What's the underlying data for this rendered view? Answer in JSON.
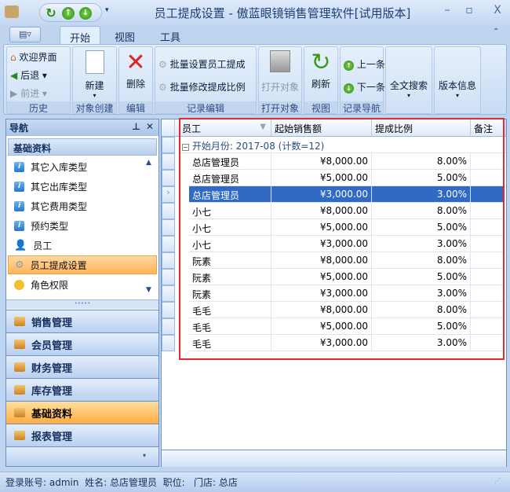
{
  "window": {
    "title": "员工提成设置 - 傲蓝眼镜销售管理软件[试用版本]",
    "minimize": "–",
    "maximize": "▫",
    "close": "X"
  },
  "ribbon_tabs": [
    {
      "label": "开始",
      "active": true
    },
    {
      "label": "视图"
    },
    {
      "label": "工具"
    }
  ],
  "ribbon": {
    "history": {
      "label": "历史",
      "welcome": "欢迎界面",
      "back": "后退",
      "forward": "前进"
    },
    "create": {
      "label": "对象创建",
      "new": "新建"
    },
    "edit": {
      "label": "编辑",
      "delete": "删除"
    },
    "record_edit": {
      "label": "记录编辑",
      "batch_set": "批量设置员工提成",
      "batch_modify": "批量修改提成比例"
    },
    "open": {
      "label": "打开对象",
      "open": "打开对象"
    },
    "view": {
      "label": "视图",
      "refresh": "刷新"
    },
    "nav": {
      "label": "记录导航",
      "prev": "上一条",
      "next": "下一条"
    },
    "search": "全文搜索",
    "version": "版本信息"
  },
  "nav": {
    "title": "导航",
    "pin": "ᵖ",
    "close": "✕",
    "section": "基础资料",
    "items": [
      {
        "label": "其它入库类型",
        "icon": "info-icon"
      },
      {
        "label": "其它出库类型",
        "icon": "info-icon"
      },
      {
        "label": "其它费用类型",
        "icon": "info-icon"
      },
      {
        "label": "预约类型",
        "icon": "info-icon"
      },
      {
        "label": "员工",
        "icon": "user-icon"
      },
      {
        "label": "员工提成设置",
        "icon": "gear-icon",
        "selected": true
      },
      {
        "label": "角色权限",
        "icon": "mask-icon"
      }
    ],
    "groups": [
      {
        "label": "销售管理"
      },
      {
        "label": "会员管理"
      },
      {
        "label": "财务管理"
      },
      {
        "label": "库存管理"
      },
      {
        "label": "基础资料",
        "selected": true
      },
      {
        "label": "报表管理"
      }
    ]
  },
  "grid": {
    "columns": [
      "员工",
      "起始销售额",
      "提成比例",
      "备注"
    ],
    "group_row": "开始月份: 2017-08 (计数=12)",
    "rows": [
      [
        "总店管理员",
        "¥8,000.00",
        "8.00%"
      ],
      [
        "总店管理员",
        "¥5,000.00",
        "5.00%"
      ],
      [
        "总店管理员",
        "¥3,000.00",
        "3.00%"
      ],
      [
        "小七",
        "¥8,000.00",
        "8.00%"
      ],
      [
        "小七",
        "¥5,000.00",
        "5.00%"
      ],
      [
        "小七",
        "¥3,000.00",
        "3.00%"
      ],
      [
        "阮素",
        "¥8,000.00",
        "8.00%"
      ],
      [
        "阮素",
        "¥5,000.00",
        "5.00%"
      ],
      [
        "阮素",
        "¥3,000.00",
        "3.00%"
      ],
      [
        "毛毛",
        "¥8,000.00",
        "8.00%"
      ],
      [
        "毛毛",
        "¥5,000.00",
        "5.00%"
      ],
      [
        "毛毛",
        "¥3,000.00",
        "3.00%"
      ]
    ],
    "selected_row": 2
  },
  "status": "登录账号: admin  姓名: 总店管理员  职位:   门店: 总店",
  "colors": {
    "accent": "#316ac5",
    "highlight": "#e8282c",
    "selected_nav": "#ffb35a"
  }
}
